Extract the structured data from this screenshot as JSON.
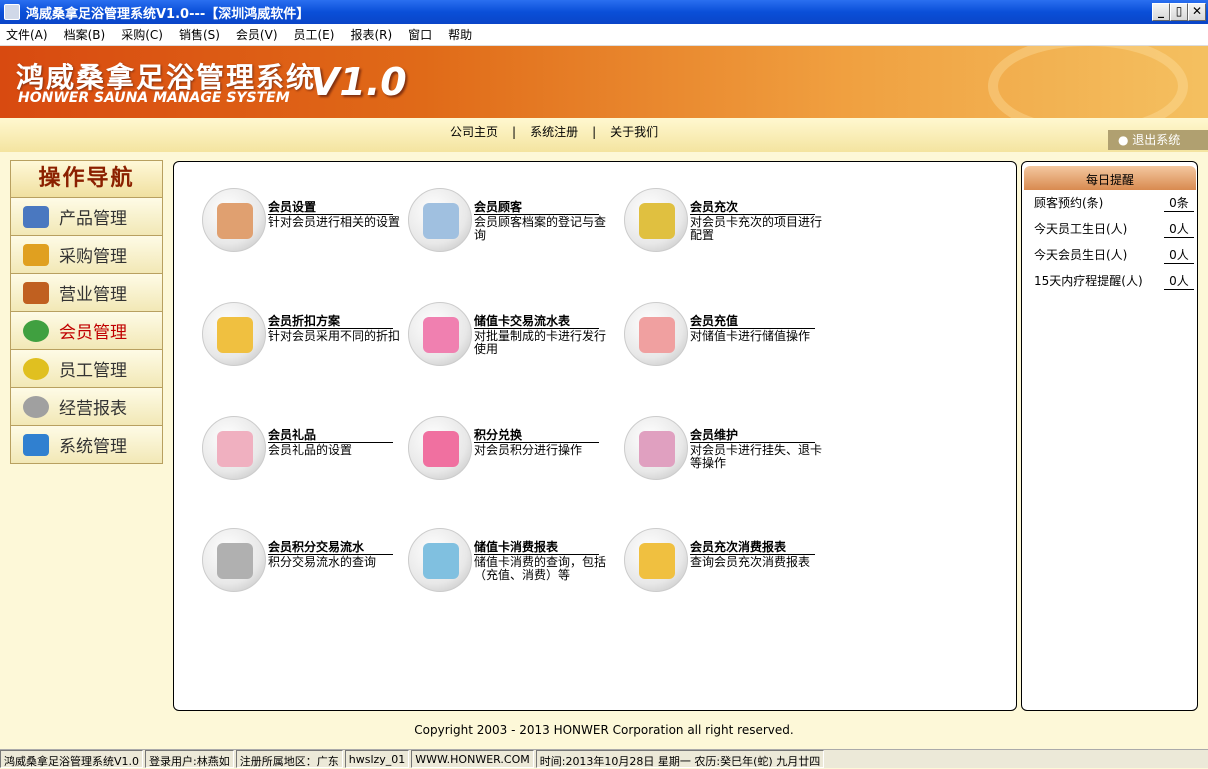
{
  "window": {
    "title": "鸿威桑拿足浴管理系统V1.0---【深圳鸿威软件】",
    "min": "_",
    "max": "▯",
    "close": "✕"
  },
  "menu": [
    "文件(A)",
    "档案(B)",
    "采购(C)",
    "销售(S)",
    "会员(V)",
    "员工(E)",
    "报表(R)",
    "窗口",
    "帮助"
  ],
  "banner": {
    "title_cn": "鸿威桑拿足浴管理系统",
    "title_en": "HONWER SAUNA MANAGE SYSTEM",
    "version": "V1.0"
  },
  "links": {
    "home": "公司主页",
    "register": "系统注册",
    "about": "关于我们",
    "exit": "● 退出系统",
    "sep": "|"
  },
  "nav": {
    "header": "操作导航",
    "items": [
      {
        "label": "产品管理",
        "icon": "product-icon",
        "color": "#4a78c0"
      },
      {
        "label": "采购管理",
        "icon": "purchase-icon",
        "color": "#e0a020"
      },
      {
        "label": "营业管理",
        "icon": "business-icon",
        "color": "#c06020"
      },
      {
        "label": "会员管理",
        "icon": "member-icon",
        "color": "#40a040"
      },
      {
        "label": "员工管理",
        "icon": "star-icon",
        "color": "#e0c020"
      },
      {
        "label": "经营报表",
        "icon": "search-icon",
        "color": "#a0a0a0"
      },
      {
        "label": "系统管理",
        "icon": "system-icon",
        "color": "#3080d0"
      }
    ]
  },
  "cards": [
    {
      "title": "会员设置",
      "desc": "针对会员进行相关的设置",
      "color": "#e0a070"
    },
    {
      "title": "会员顾客",
      "desc": "会员顾客档案的登记与查询",
      "color": "#a0c0e0"
    },
    {
      "title": "会员充次",
      "desc": "对会员卡充次的项目进行配置",
      "color": "#e0c040"
    },
    {
      "title": "会员折扣方案",
      "desc": "针对会员采用不同的折扣",
      "color": "#f0c040"
    },
    {
      "title": "储值卡交易流水表",
      "desc": "对批量制成的卡进行发行使用",
      "color": "#f080b0"
    },
    {
      "title": "会员充值",
      "desc": "对储值卡进行储值操作",
      "color": "#f0a0a0"
    },
    {
      "title": "会员礼品",
      "desc": "会员礼品的设置",
      "color": "#f0b0c0"
    },
    {
      "title": "积分兑换",
      "desc": "对会员积分进行操作",
      "color": "#f070a0"
    },
    {
      "title": "会员维护",
      "desc": "对会员卡进行挂失、退卡等操作",
      "color": "#e0a0c0"
    },
    {
      "title": "会员积分交易流水",
      "desc": "积分交易流水的查询",
      "color": "#b0b0b0"
    },
    {
      "title": "储值卡消费报表",
      "desc": "储值卡消费的查询，包括（充值、消费）等",
      "color": "#80c0e0"
    },
    {
      "title": "会员充次消费报表",
      "desc": "查询会员充次消费报表",
      "color": "#f0c040"
    }
  ],
  "reminder": {
    "header": "每日提醒",
    "rows": [
      {
        "label": "顾客预约(条)",
        "value": "0条"
      },
      {
        "label": "今天员工生日(人)",
        "value": "0人"
      },
      {
        "label": "今天会员生日(人)",
        "value": "0人"
      },
      {
        "label": "15天内疗程提醒(人)",
        "value": "0人"
      }
    ]
  },
  "copyright": "Copyright 2003 - 2013 HONWER Corporation all right reserved.",
  "status": [
    "鸿威桑拿足浴管理系统V1.0",
    "登录用户:林燕如",
    "注册所属地区：广东",
    "hwslzy_01",
    "WWW.HONWER.COM",
    "时间:2013年10月28日  星期一  农历:癸巳年(蛇) 九月廿四"
  ]
}
